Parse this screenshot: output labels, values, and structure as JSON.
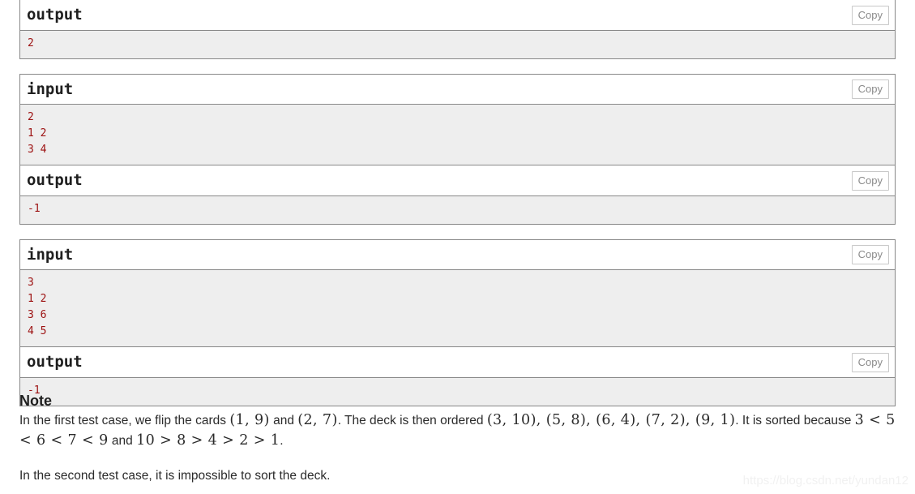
{
  "page": {
    "note_heading": "Note",
    "watermark": "https://blog.csdn.net/yundan12"
  },
  "copy_label": "Copy",
  "sample_tests": [
    {
      "blocks": [
        {
          "kind": "output",
          "title": "output",
          "copy_label": "Copy",
          "content": "2"
        }
      ]
    },
    {
      "blocks": [
        {
          "kind": "input",
          "title": "input",
          "copy_label": "Copy",
          "content": "2\n1 2\n3 4"
        },
        {
          "kind": "output",
          "title": "output",
          "copy_label": "Copy",
          "content": "-1"
        }
      ]
    },
    {
      "blocks": [
        {
          "kind": "input",
          "title": "input",
          "copy_label": "Copy",
          "content": "3\n1 2\n3 6\n4 5"
        },
        {
          "kind": "output",
          "title": "output",
          "copy_label": "Copy",
          "content": "-1"
        }
      ]
    }
  ],
  "note": {
    "paragraph1": {
      "seg1": "In the first test case, we flip the cards ",
      "math1": "(1, 9)",
      "seg2": " and ",
      "math2": "(2, 7)",
      "seg3": ". The deck is then ordered ",
      "math3": "(3, 10), (5, 8), (6, 4), (7, 2), (9, 1)",
      "seg4": ". It is sorted because ",
      "math4": "3 < 5 < 6 < 7 < 9",
      "seg5": " and ",
      "math5": "10 > 8 > 4 > 2 > 1",
      "seg6": "."
    },
    "paragraph2": "In the second test case, it is impossible to sort the deck."
  }
}
